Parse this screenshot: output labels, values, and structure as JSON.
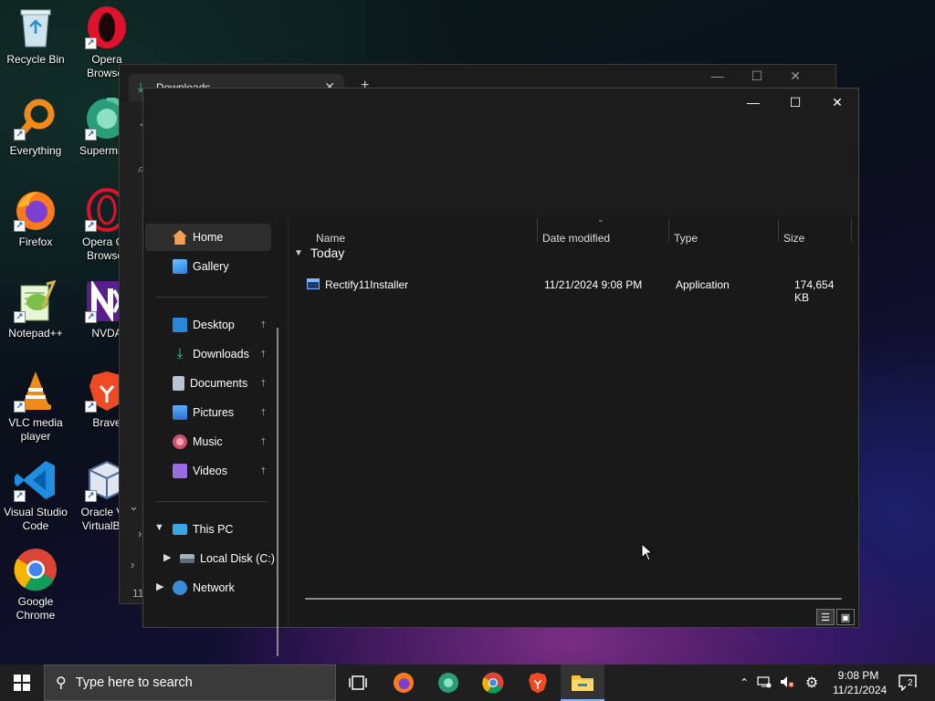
{
  "desktop": {
    "icons": [
      {
        "label": "Recycle Bin",
        "name": "recycle-bin-icon"
      },
      {
        "label": "Opera Browser",
        "name": "opera-icon"
      },
      {
        "label": "Everything",
        "name": "everything-icon"
      },
      {
        "label": "Supermium",
        "name": "supermium-icon"
      },
      {
        "label": "Firefox",
        "name": "firefox-icon"
      },
      {
        "label": "Opera GX Browser",
        "name": "opera-gx-icon"
      },
      {
        "label": "Notepad++",
        "name": "notepadpp-icon"
      },
      {
        "label": "NVDA",
        "name": "nvda-icon"
      },
      {
        "label": "VLC media player",
        "name": "vlc-icon"
      },
      {
        "label": "Brave",
        "name": "brave-icon"
      },
      {
        "label": "Visual Studio Code",
        "name": "vscode-icon"
      },
      {
        "label": "Oracle VM VirtualBox",
        "name": "virtualbox-icon"
      },
      {
        "label": "Google Chrome",
        "name": "chrome-icon"
      }
    ]
  },
  "background_window": {
    "tab_title": "Downloads",
    "marks": {
      "left": "←",
      "search": "⌕",
      "chev1": "⌄",
      "chev2": "›",
      "chev3": "›",
      "count": "11"
    }
  },
  "explorer": {
    "window_controls": {
      "minimize": "—",
      "maximize": "☐",
      "close": "✕"
    },
    "nav": {
      "home": "Home",
      "gallery": "Gallery",
      "desktop": "Desktop",
      "downloads": "Downloads",
      "documents": "Documents",
      "pictures": "Pictures",
      "music": "Music",
      "videos": "Videos",
      "this_pc": "This PC",
      "local_disk": "Local Disk (C:)",
      "network": "Network",
      "pin_glyph": "†"
    },
    "columns": {
      "name": "Name",
      "date": "Date modified",
      "type": "Type",
      "size": "Size"
    },
    "group": "Today",
    "files": [
      {
        "name": "Rectify11Installer",
        "date": "11/21/2024 9:08 PM",
        "type": "Application",
        "size": "174,654 KB"
      }
    ]
  },
  "taskbar": {
    "search_placeholder": "Type here to search",
    "clock_time": "9:08 PM",
    "clock_date": "11/21/2024",
    "notification_count": "2"
  }
}
